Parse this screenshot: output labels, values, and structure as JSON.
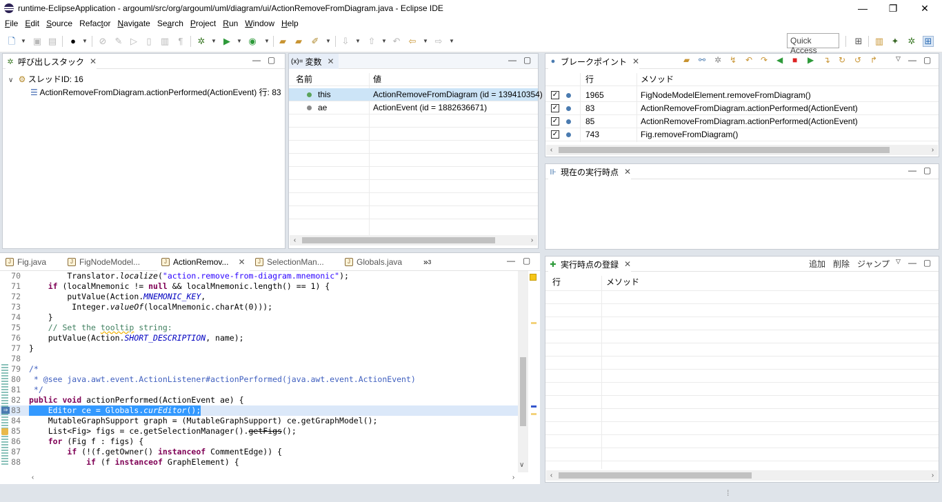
{
  "window": {
    "title": "runtime-EclipseApplication - argouml/src/org/argouml/uml/diagram/ui/ActionRemoveFromDiagram.java - Eclipse IDE",
    "minimize": "—",
    "restore": "❐",
    "close": "✕"
  },
  "menu": [
    {
      "label": "File",
      "mn": "F",
      "rest": "ile"
    },
    {
      "label": "Edit",
      "mn": "E",
      "rest": "dit"
    },
    {
      "label": "Source",
      "mn": "S",
      "rest": "ource"
    },
    {
      "label": "Refactor",
      "mn": "R",
      "pre": "Refac",
      "mn2": "t",
      "rest2": "or"
    },
    {
      "label": "Navigate",
      "mn": "N",
      "rest": "avigate"
    },
    {
      "label": "Search",
      "pre": "Se",
      "mn2": "a",
      "rest2": "rch"
    },
    {
      "label": "Project",
      "mn": "P",
      "rest": "roject"
    },
    {
      "label": "Run",
      "mn": "R",
      "rest": "un"
    },
    {
      "label": "Window",
      "mn": "W",
      "rest": "indow"
    },
    {
      "label": "Help",
      "mn": "H",
      "rest": "elp"
    }
  ],
  "toolbar": {
    "quick_access": "Quick Access"
  },
  "callstack": {
    "tab": "呼び出しスタック",
    "thread": "スレッドID: 16",
    "frame": "ActionRemoveFromDiagram.actionPerformed(ActionEvent) 行: 83"
  },
  "variables": {
    "tab": "変数",
    "tab_prefix": "(x)=",
    "col_name": "名前",
    "col_value": "値",
    "rows": [
      {
        "name": "this",
        "value": "ActionRemoveFromDiagram (id = 139410354)"
      },
      {
        "name": "ae",
        "value": "ActionEvent (id = 1882636671)"
      }
    ]
  },
  "breakpoints": {
    "tab": "ブレークポイント",
    "col_line": "行",
    "col_method": "メソッド",
    "rows": [
      {
        "line": "1965",
        "method": "FigNodeModelElement.removeFromDiagram()"
      },
      {
        "line": "83",
        "method": "ActionRemoveFromDiagram.actionPerformed(ActionEvent)"
      },
      {
        "line": "85",
        "method": "ActionRemoveFromDiagram.actionPerformed(ActionEvent)"
      },
      {
        "line": "743",
        "method": "Fig.removeFromDiagram()"
      }
    ]
  },
  "current_point": {
    "tab": "現在の実行時点"
  },
  "registry": {
    "tab": "実行時点の登録",
    "add": "追加",
    "delete": "削除",
    "jump": "ジャンプ",
    "col_line": "行",
    "col_method": "メソッド"
  },
  "editor": {
    "tabs": [
      "Fig.java",
      "FigNodeModel...",
      "ActionRemov...",
      "SelectionMan...",
      "Globals.java"
    ],
    "overflow": "»",
    "overflow_count": "3",
    "lines": [
      {
        "n": "70"
      },
      {
        "n": "71"
      },
      {
        "n": "72"
      },
      {
        "n": "73"
      },
      {
        "n": "74"
      },
      {
        "n": "75"
      },
      {
        "n": "76"
      },
      {
        "n": "77"
      },
      {
        "n": "78"
      },
      {
        "n": "79"
      },
      {
        "n": "80"
      },
      {
        "n": "81"
      },
      {
        "n": "82"
      },
      {
        "n": "83"
      },
      {
        "n": "84"
      },
      {
        "n": "85"
      },
      {
        "n": "86"
      },
      {
        "n": "87"
      },
      {
        "n": "88"
      }
    ]
  },
  "colors": {
    "selection": "#3399ff",
    "keyword": "#7f0055",
    "string": "#2a00ff",
    "comment": "#3f7f5f"
  }
}
